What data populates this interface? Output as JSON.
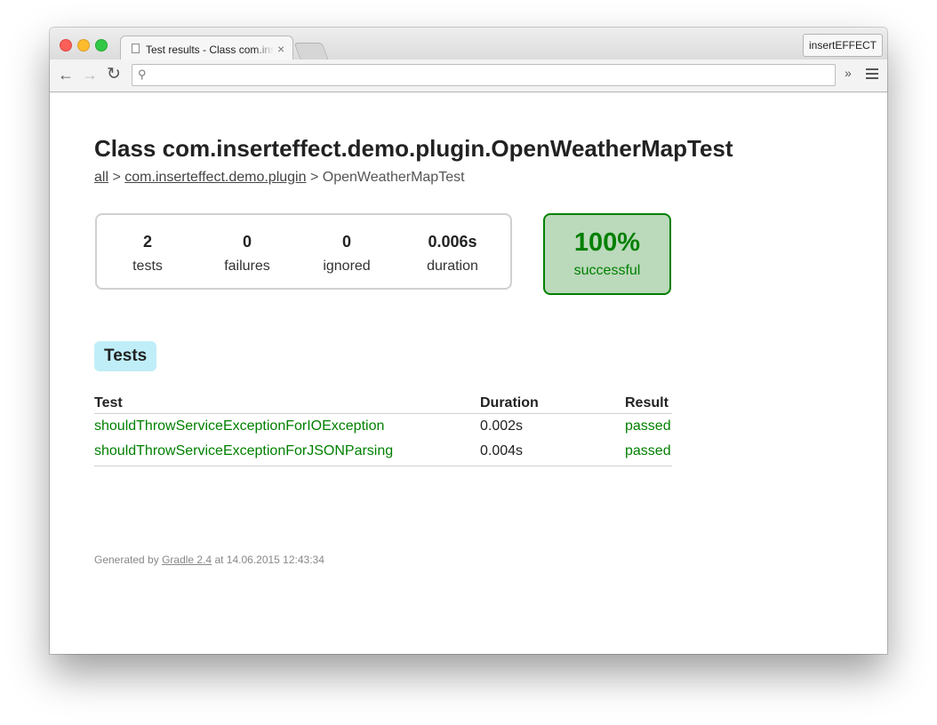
{
  "browser": {
    "tab_title": "Test results - Class com.insertettect.demo.plugin.OpenWeatherMapTest",
    "tab_close": "×",
    "profile_button": "insertEFFECT",
    "omnibox_value": "",
    "back_glyph": "←",
    "forward_glyph": "→",
    "reload_glyph": "↻",
    "search_glyph": "⚲",
    "extensions_glyph": "»"
  },
  "page": {
    "title": "Class com.inserteffect.demo.plugin.OpenWeatherMapTest",
    "breadcrumb": {
      "all": "all",
      "sep1": " > ",
      "package": "com.inserteffect.demo.plugin",
      "sep2": " > ",
      "current": "OpenWeatherMapTest"
    },
    "summary": {
      "tests": {
        "value": "2",
        "label": "tests"
      },
      "failures": {
        "value": "0",
        "label": "failures"
      },
      "ignored": {
        "value": "0",
        "label": "ignored"
      },
      "duration": {
        "value": "0.006s",
        "label": "duration"
      }
    },
    "success": {
      "percent": "100%",
      "label": "successful"
    },
    "tests_tab": "Tests",
    "table": {
      "headers": {
        "test": "Test",
        "duration": "Duration",
        "result": "Result"
      },
      "rows": [
        {
          "test": "shouldThrowServiceExceptionForIOException",
          "duration": "0.002s",
          "result": "passed"
        },
        {
          "test": "shouldThrowServiceExceptionForJSONParsing",
          "duration": "0.004s",
          "result": "passed"
        }
      ]
    },
    "footer": {
      "prefix": "Generated by ",
      "link": "Gradle 2.4",
      "suffix": " at 14.06.2015 12:43:34"
    }
  },
  "colors": {
    "success_green": "#008000",
    "success_bg": "#bbd9bb",
    "tab_bg": "#c0eef8"
  }
}
